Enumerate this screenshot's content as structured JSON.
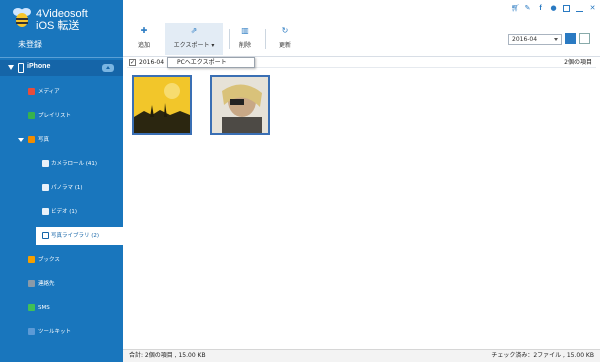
{
  "app": {
    "name_line1": "4Videosoft",
    "name_line2": "iOS 転送",
    "unregistered": "未登録"
  },
  "device": {
    "name": "iPhone"
  },
  "sidebar": {
    "items": [
      {
        "label": "メディア",
        "icon": "music-icon",
        "color": "#e74c3c"
      },
      {
        "label": "プレイリスト",
        "icon": "playlist-icon",
        "color": "#37b24d"
      },
      {
        "label": "写真",
        "icon": "photos-icon",
        "color": "#f08c00"
      },
      {
        "label": "カメラロール (41)",
        "icon": "folder-icon"
      },
      {
        "label": "パノラマ (1)",
        "icon": "folder-icon"
      },
      {
        "label": "ビデオ (1)",
        "icon": "folder-icon"
      },
      {
        "label": "写真ライブラリ (2)",
        "icon": "folder-icon",
        "selected": true
      },
      {
        "label": "ブックス",
        "icon": "books-icon",
        "color": "#f59f00"
      },
      {
        "label": "連絡先",
        "icon": "contacts-icon",
        "color": "#8a9aa8"
      },
      {
        "label": "SMS",
        "icon": "sms-icon",
        "color": "#40c057"
      },
      {
        "label": "ツールキット",
        "icon": "toolkit-icon",
        "color": "#5c9ad6"
      }
    ]
  },
  "toolbar": {
    "add": "追加",
    "export": "エクスポート",
    "delete": "削除",
    "refresh": "更新"
  },
  "filter": {
    "date": "2016-04"
  },
  "group": {
    "date": "2016-04",
    "count": "2個の項目"
  },
  "menu": {
    "export_pc": "PCへエクスポート"
  },
  "status": {
    "total": "合計:  2個の項目 , 15.00 KB",
    "checked": "チェック済み：2ファイル , 15.00 KB"
  },
  "colors": {
    "sidebar": "#1976bd",
    "accent": "#2a7ac2",
    "thumb_border": "#3a6fb4"
  }
}
